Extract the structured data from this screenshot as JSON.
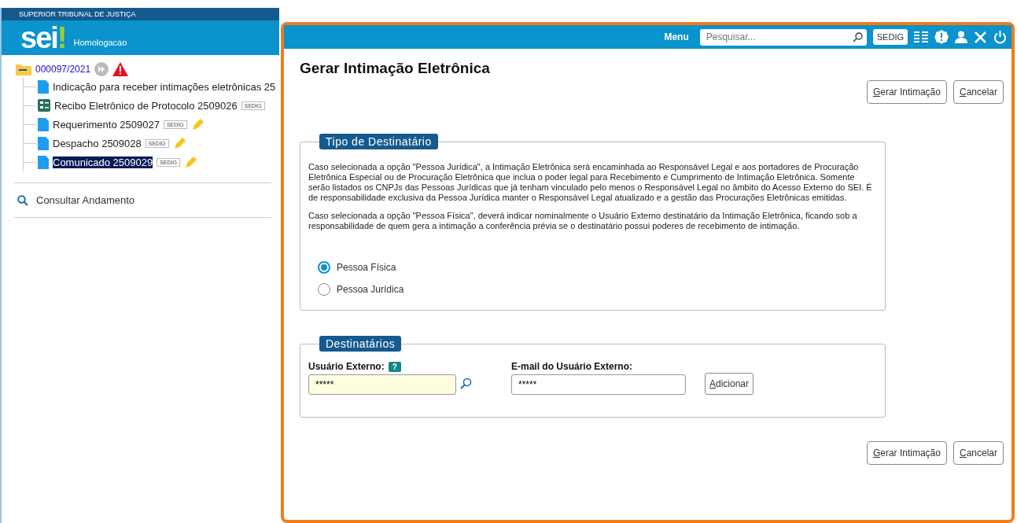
{
  "top_strip": {
    "org": "SUPERIOR TRIBUNAL DE JUSTIÇA"
  },
  "brand": {
    "logo": "sei",
    "logo_mark": "!",
    "environment": "Homologacao"
  },
  "tree": {
    "process": "000097/2021",
    "children": [
      {
        "kind": "doc",
        "label": "Indicação para receber intimações eletrônicas 25",
        "pen": false,
        "selected": false
      },
      {
        "kind": "receipt",
        "label": "Recibo Eletrônico de Protocolo 2509026",
        "badge": "SEDIG",
        "pen": false,
        "selected": false
      },
      {
        "kind": "doc",
        "label": "Requerimento 2509027",
        "badge": "SEDIG",
        "pen": true,
        "selected": false
      },
      {
        "kind": "doc",
        "label": "Despacho 2509028",
        "badge": "SEDIG",
        "pen": true,
        "selected": false
      },
      {
        "kind": "doc",
        "label": "Comunicado 2509029",
        "badge": "SEDIG",
        "pen": true,
        "selected": true
      }
    ]
  },
  "sidebar_link": "Consultar Andamento",
  "topbar": {
    "menu": "Menu",
    "search": {
      "placeholder": "Pesquisar..."
    },
    "unit": "SEDIG"
  },
  "page_title": "Gerar Intimação Eletrônica",
  "buttons": [
    "Gerar Intimação",
    "Cancelar"
  ],
  "tipo": {
    "legend": "Tipo de Destinatário",
    "paragraphs": [
      "Caso selecionada a opção \"Pessoa Jurídica\", a Intimação Eletrônica será encaminhada ao Responsável Legal e aos portadores de Procuração Eletrônica Especial ou de Procuração Eletrônica que inclua o poder legal para Recebimento e Cumprimento de Intimação Eletrônica. Somente serão listados os CNPJs das Pessoas Jurídicas que já tenham vinculado pelo menos o Responsável Legal no âmbito do Acesso Externo do SEI. É de responsabilidade exclusiva da Pessoa Jurídica manter o Responsável Legal atualizado e a gestão das Procurações Eletrônicas emitidas.",
      "Caso selecionada a opção \"Pessoa Física\", deverá indicar nominalmente o Usuário Externo destinatário da Intimação Eletrônica, ficando sob a responsabilidade de quem gera a intimação a conferência prévia se o destinatário possui poderes de recebimento de intimação."
    ],
    "options": [
      {
        "label": "Pessoa Física",
        "selected": true
      },
      {
        "label": "Pessoa Jurídica",
        "selected": false
      }
    ]
  },
  "destinatarios": {
    "legend": "Destinatários",
    "user_label": "Usuário Externo:",
    "help": "?",
    "user_value": "*****",
    "email_label": "E-mail do Usuário Externo:",
    "email_value": "*****",
    "add_button": "Adicionar"
  },
  "bottom_buttons": [
    "Gerar Intimação",
    "Cancelar"
  ]
}
